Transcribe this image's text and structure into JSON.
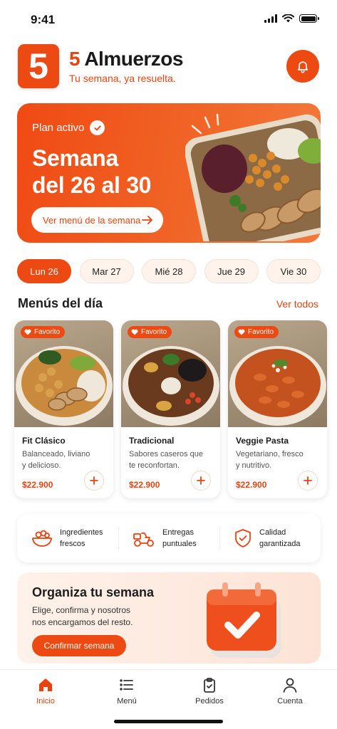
{
  "status_bar": {
    "time": "9:41"
  },
  "header": {
    "logo_number": "5",
    "brand_number": "5",
    "brand_name": "Almuerzos",
    "tagline": "Tu semana, ya resuelta."
  },
  "hero": {
    "status": "Plan activo",
    "title_line1": "Semana",
    "title_line2": "del 26 al 30",
    "button_label": "Ver menú de la semana"
  },
  "days": [
    {
      "label": "Lun 26",
      "active": true
    },
    {
      "label": "Mar 27",
      "active": false
    },
    {
      "label": "Mié 28",
      "active": false
    },
    {
      "label": "Jue 29",
      "active": false
    },
    {
      "label": "Vie 30",
      "active": false
    }
  ],
  "menus": {
    "title": "Menús del día",
    "see_all": "Ver todos",
    "items": [
      {
        "badge": "Favorito",
        "name": "Fit Clásico",
        "desc_line1": "Balanceado, liviano",
        "desc_line2": "y delicioso.",
        "price": "$22.900"
      },
      {
        "badge": "Favorito",
        "name": "Tradicional",
        "desc_line1": "Sabores caseros que",
        "desc_line2": "te reconfortan.",
        "price": "$22.900"
      },
      {
        "badge": "Favorito",
        "name": "Veggie Pasta",
        "desc_line1": "Vegetariano, fresco",
        "desc_line2": "y nutritivo.",
        "price": "$22.900"
      }
    ]
  },
  "features": [
    {
      "line1": "Ingredientes",
      "line2": "frescos",
      "icon": "salad-bowl-icon"
    },
    {
      "line1": "Entregas",
      "line2": "puntuales",
      "icon": "scooter-icon"
    },
    {
      "line1": "Calidad",
      "line2": "garantizada",
      "icon": "shield-check-icon"
    }
  ],
  "promo": {
    "title": "Organiza tu semana",
    "text_line1": "Elige, confirma y nosotros",
    "text_line2": "nos encargamos del resto.",
    "button_label": "Confirmar semana"
  },
  "tabbar": [
    {
      "label": "Inicio",
      "icon": "home-icon",
      "active": true
    },
    {
      "label": "Menú",
      "icon": "list-icon",
      "active": false
    },
    {
      "label": "Pedidos",
      "icon": "clipboard-icon",
      "active": false
    },
    {
      "label": "Cuenta",
      "icon": "user-icon",
      "active": false
    }
  ],
  "colors": {
    "accent": "#EC4A12",
    "accent_light": "#FFF3EC",
    "text": "#1D1D1D"
  }
}
